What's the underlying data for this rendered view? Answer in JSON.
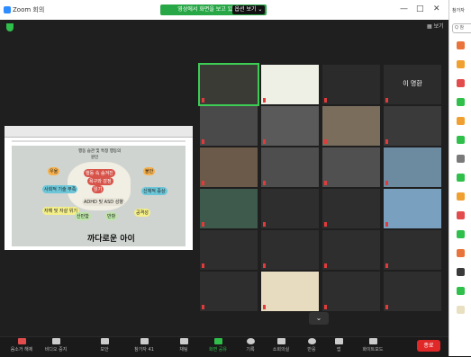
{
  "window": {
    "title": "Zoom 회의",
    "minimize": "—",
    "maximize": "□",
    "close": "✕"
  },
  "banner": {
    "text": "영상에서 화면을 보고 있습니다.",
    "button": "옵션 보기 ⌄"
  },
  "view_button": "▦ 보기",
  "slide": {
    "title": "까다로운 아이",
    "center_lines": [
      "행동 속 숨겨진",
      "욕구와 감정",
      "읽기"
    ],
    "top_lines": [
      "행동 습관 및 특정 행동의",
      "원인"
    ],
    "pills": [
      "우울",
      "불안",
      "사회적 기술 부족",
      "신체적 증상",
      "자해 및 자살 위기",
      "공격성",
      "산만함",
      "반항"
    ],
    "mid_pills": [
      "ADHD 및 ASD 성향"
    ]
  },
  "participants": [
    {
      "label": "",
      "big": ""
    },
    {
      "label": "",
      "big": ""
    },
    {
      "label": "",
      "big": ""
    },
    {
      "label": "",
      "big": "이 명환"
    },
    {
      "label": "",
      "big": ""
    },
    {
      "label": "",
      "big": ""
    },
    {
      "label": "",
      "big": ""
    },
    {
      "label": "",
      "big": ""
    },
    {
      "label": "",
      "big": ""
    },
    {
      "label": "",
      "big": ""
    },
    {
      "label": "",
      "big": ""
    },
    {
      "label": "",
      "big": ""
    },
    {
      "label": "",
      "big": ""
    },
    {
      "label": "",
      "big": ""
    },
    {
      "label": "",
      "big": ""
    },
    {
      "label": "",
      "big": ""
    },
    {
      "label": "",
      "big": ""
    },
    {
      "label": "",
      "big": ""
    },
    {
      "label": "",
      "big": ""
    },
    {
      "label": "",
      "big": ""
    },
    {
      "label": "",
      "big": ""
    },
    {
      "label": "",
      "big": ""
    },
    {
      "label": "",
      "big": ""
    },
    {
      "label": "",
      "big": ""
    }
  ],
  "toolbar": {
    "mute": "음소거 해제",
    "video": "비디오 중지",
    "security": "보안",
    "participants": "참가자",
    "participants_count": "41",
    "chat": "채팅",
    "share": "화면 공유",
    "record": "기록",
    "breakout": "소회의실",
    "reactions": "반응",
    "apps": "앱",
    "whiteboard": "화이트보드",
    "end": "종료"
  },
  "sidebar": {
    "header": "참가자",
    "search_placeholder": "Q 참"
  },
  "colors": {
    "accent": "#27a745",
    "end": "#e02828",
    "speaker": "#3ccd54"
  }
}
